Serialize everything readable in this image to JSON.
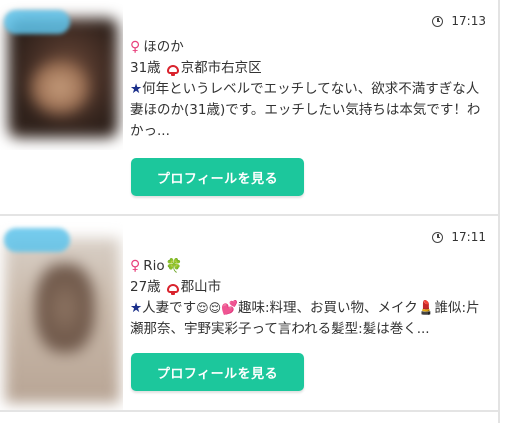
{
  "posts": [
    {
      "time": "17:13",
      "name": "ほのか",
      "name_suffix_icon": "",
      "age": "31歳",
      "location": "京都市右京区",
      "desc_lead_icon": "★",
      "desc_part1": "何年というレベルでエッチしてない、欲求不満すぎな人妻ほのか(31歳)です。エッチしたい気持ちは本気です！わかっ...",
      "button_label": "プロフィールを見る"
    },
    {
      "time": "17:11",
      "name": "Rio",
      "name_suffix_icon": "🍀",
      "age": "27歳",
      "location": "郡山市",
      "desc_lead_icon": "★",
      "desc_part1": "人妻です",
      "desc_emojis": "😌😌",
      "desc_heart": "💕",
      "desc_part2": "趣味:料理、お買い物、メイク",
      "desc_lipstick": "💄",
      "desc_part3": "誰似:片瀬那奈、宇野実彩子って言われる髪型:髪は巻く...",
      "button_label": "プロフィールを見る"
    }
  ],
  "icons": {
    "gender": "♀",
    "clock": "clock-icon",
    "location": "pin-icon"
  },
  "colors": {
    "button": "#1cc79c",
    "female": "#e8417d",
    "star": "#1a2f8a",
    "pin": "#d9232d"
  }
}
